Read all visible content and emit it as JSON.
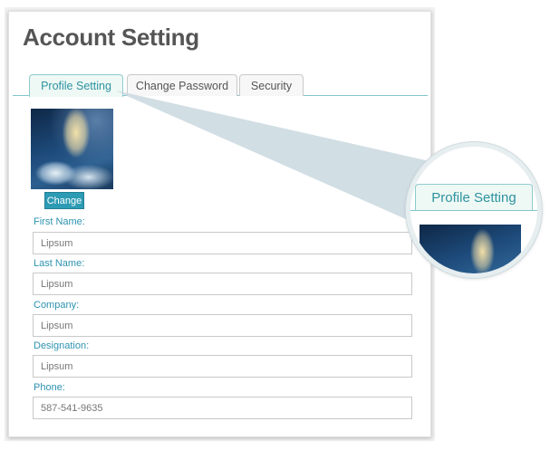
{
  "page": {
    "title": "Account Setting"
  },
  "tabs": [
    {
      "label": "Profile Setting",
      "active": true
    },
    {
      "label": "Change Password",
      "active": false
    },
    {
      "label": "Security",
      "active": false
    }
  ],
  "profile": {
    "change_button": "Change",
    "fields": {
      "first_name": {
        "label": "First Name:",
        "value": "Lipsum"
      },
      "last_name": {
        "label": "Last Name:",
        "value": "Lipsum"
      },
      "company": {
        "label": "Company:",
        "value": "Lipsum"
      },
      "designation": {
        "label": "Designation:",
        "value": "Lipsum"
      },
      "phone": {
        "label": "Phone:",
        "value": "587-541-9635"
      }
    }
  },
  "magnifier": {
    "tab_label": "Profile Setting"
  },
  "colors": {
    "accent": "#2d93b0",
    "button": "#2d9bb4",
    "tab_active_bg": "#eef8f4"
  }
}
